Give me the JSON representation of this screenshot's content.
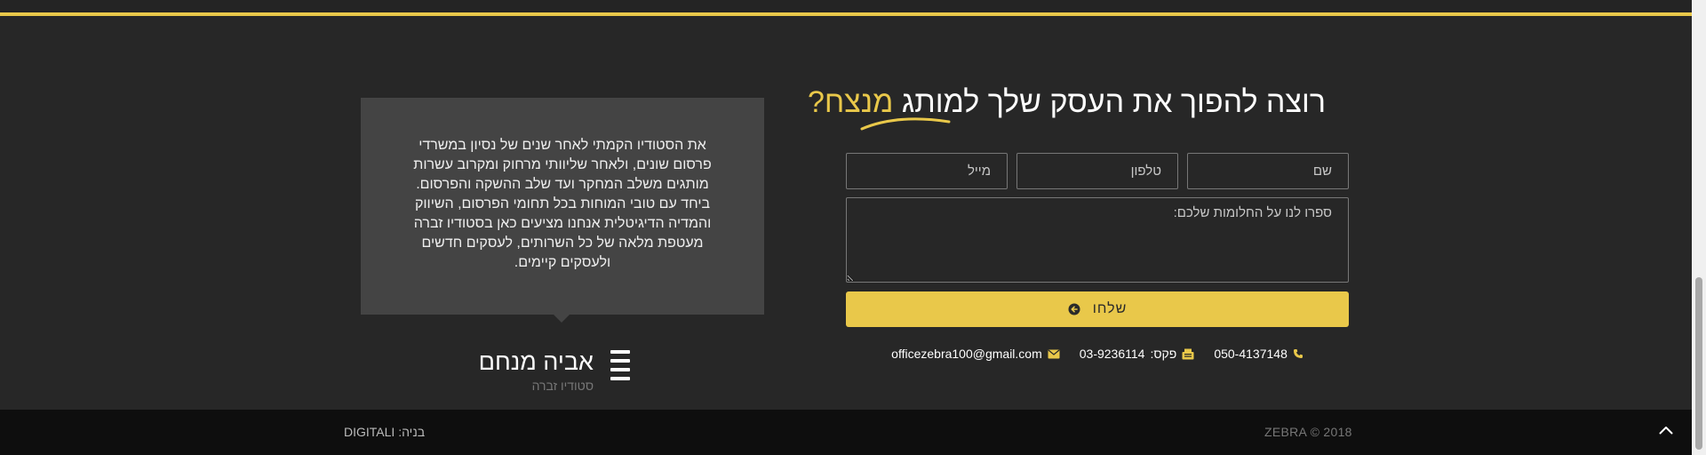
{
  "testimonial": {
    "text": "את הסטודיו הקמתי לאחר שנים של נסיון במשרדי פרסום שונים, ולאחר שליוותי מרחוק ומקרוב עשרות מותגים משלב המחקר ועד שלב ההשקה והפרסום. ביחד עם טובי המוחות בכל תחומי הפרסום, השיווק והמדיה הדיגיטלית אנחנו מציעים כאן בסטודיו זברה מעטפת מלאה של כל השרותים, לעסקים חדשים ולעסקים קיימים.",
    "author_name": "אביה מנחם",
    "author_company": "סטודיו זברה",
    "logo_icon": "zebra-lines-icon"
  },
  "form": {
    "heading_main": "רוצה להפוך את העסק שלך למותג ",
    "heading_accent": "מנצח?",
    "name_placeholder": "שם",
    "phone_placeholder": "טלפון",
    "email_placeholder": "מייל",
    "message_placeholder": "ספרו לנו על החלומות שלכם:",
    "submit_label": "שלחו",
    "submit_icon": "arrow-circle-icon"
  },
  "contact": {
    "phone": "050-4137148",
    "phone_icon": "phone-icon",
    "fax_label": "פקס:",
    "fax": "03-9236114",
    "fax_icon": "fax-icon",
    "email": "officezebra100@gmail.com",
    "email_icon": "envelope-icon"
  },
  "footer": {
    "built_by": "בניה: DIGITALI",
    "copyright": "ZEBRA © 2018",
    "back_to_top_icon": "chevron-up-icon"
  },
  "colors": {
    "accent": "#e9c84a",
    "background": "#272727",
    "box": "#444444",
    "footer": "#0e0e0e"
  }
}
